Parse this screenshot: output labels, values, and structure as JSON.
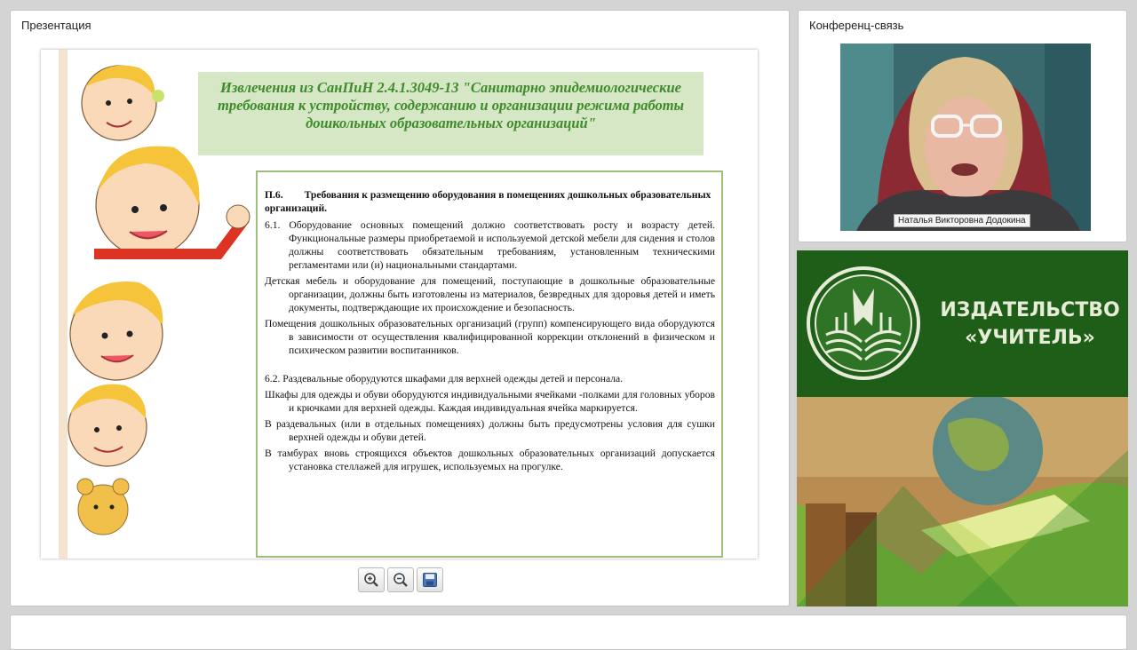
{
  "presentation": {
    "title": "Презентация",
    "slide": {
      "heading": "Извлечения из СанПиН 2.4.1.3049-13 \"Санитарно эпидемиологические требования к устройству, содержанию и организации режима работы дошкольных образовательных организаций\"",
      "section_num": "П.6.",
      "section_title": "Требования к размещению оборудования в помещениях дошкольных образовательных организаций.",
      "paragraphs": [
        "6.1. Оборудование основных помещений должно соответствовать росту и возрасту детей. Функциональные размеры приобретаемой и используемой детской мебели для сидения и столов должны соответствовать обязательным требованиям, установленным техническими регламентами или (и) национальными стандартами.",
        "Детская мебель и оборудование для помещений, поступающие в дошкольные образовательные организации, должны быть изготовлены из материалов, безвредных для здоровья детей и иметь документы, подтверждающие их происхождение и безопасность.",
        "Помещения дошкольных образовательных организаций (групп) компенсирующего вида оборудуются в зависимости от осуществления квалифицированной коррекции отклонений в физическом и психическом развитии воспитанников.",
        "6.2. Раздевальные оборудуются шкафами для верхней одежды детей и персонала.",
        "Шкафы для одежды и обуви оборудуются индивидуальными ячейками -полками для головных уборов и крючками для верхней одежды. Каждая индивидуальная ячейка маркируется.",
        "В раздевальных (или в отдельных помещениях) должны быть предусмотрены условия для сушки верхней одежды и обуви детей.",
        "В тамбурах вновь строящихся объектов дошкольных образовательных организаций допускается установка стеллажей для игрушек, используемых на прогулке."
      ]
    },
    "toolbar": {
      "zoom_in": "zoom-in-icon",
      "zoom_out": "zoom-out-icon",
      "save": "save-icon"
    }
  },
  "conference": {
    "title": "Конференц-связь",
    "speaker_name": "Наталья Викторовна Додокина"
  },
  "promo": {
    "line1": "ИЗДАТЕЛЬСТВО",
    "line2": "«УЧИТЕЛЬ»"
  },
  "colors": {
    "promo_green": "#1f5e18",
    "heading_bg": "#d6e7c5",
    "heading_text": "#3f8a2c",
    "box_border": "#9cc07c"
  }
}
